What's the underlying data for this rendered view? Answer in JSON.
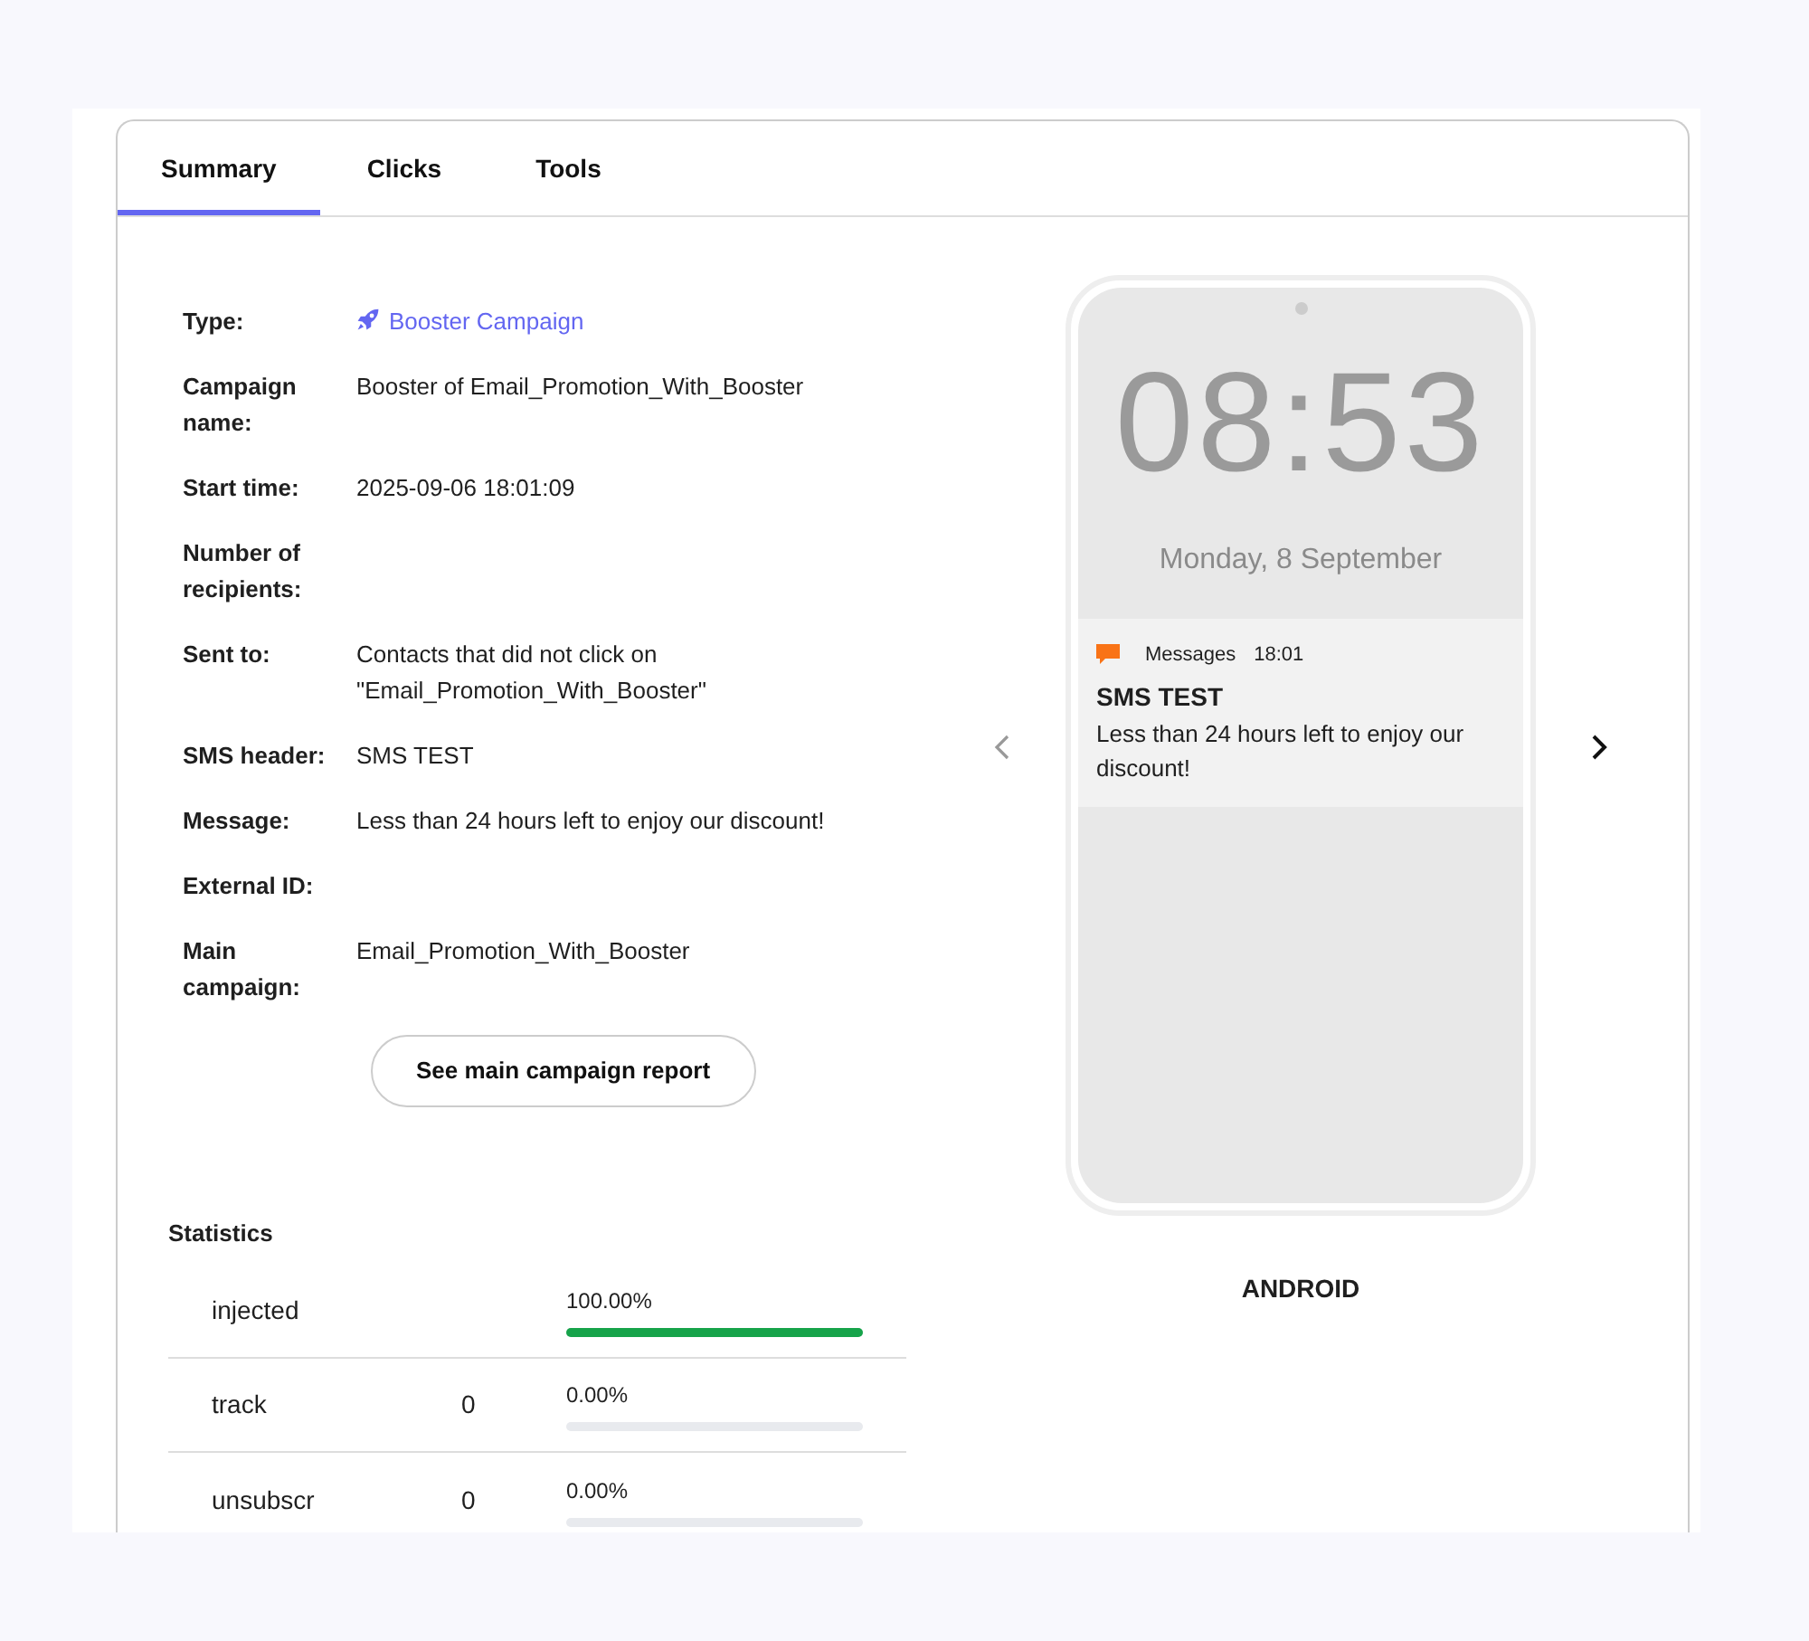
{
  "tabs": [
    {
      "label": "Summary",
      "selected": true
    },
    {
      "label": "Clicks",
      "selected": false
    },
    {
      "label": "Tools",
      "selected": false
    }
  ],
  "details": [
    {
      "label": "Type:",
      "value": "Booster Campaign",
      "kind": "link"
    },
    {
      "label": "Campaign name:",
      "value": "Booster of Email_Promotion_With_Booster",
      "kind": "text"
    },
    {
      "label": "Start time:",
      "value": "2025-09-06 18:01:09",
      "kind": "text"
    },
    {
      "label": "Number of recipients:",
      "kind": "text"
    },
    {
      "label": "Sent to:",
      "value": "Contacts that did not click on \"Email_Promotion_With_Booster\"",
      "kind": "text"
    },
    {
      "label": "SMS header:",
      "value": "SMS TEST",
      "kind": "text"
    },
    {
      "label": "Message:",
      "value": "Less than 24 hours left to enjoy our discount!",
      "kind": "text"
    },
    {
      "label": "External ID:",
      "kind": "text"
    },
    {
      "label": "Main campaign:",
      "value": "Email_Promotion_With_Booster",
      "kind": "text"
    }
  ],
  "report_button": "See main campaign report",
  "statistics": {
    "title": "Statistics",
    "rows": [
      {
        "name": "injected",
        "percent": "100.00%",
        "level": 1
      },
      {
        "name": "track",
        "count": "0",
        "percent": "0.00%",
        "level": 0
      },
      {
        "name": "unsubscr",
        "count": "0",
        "percent": "0.00%",
        "level": 0
      }
    ]
  },
  "preview": {
    "clock": "08:53",
    "date": "Monday, 8 September",
    "notification": {
      "app": "Messages",
      "time": "18:01",
      "title": "SMS TEST",
      "body": "Less than 24 hours left to enjoy our discount!"
    },
    "platform": "ANDROID"
  }
}
